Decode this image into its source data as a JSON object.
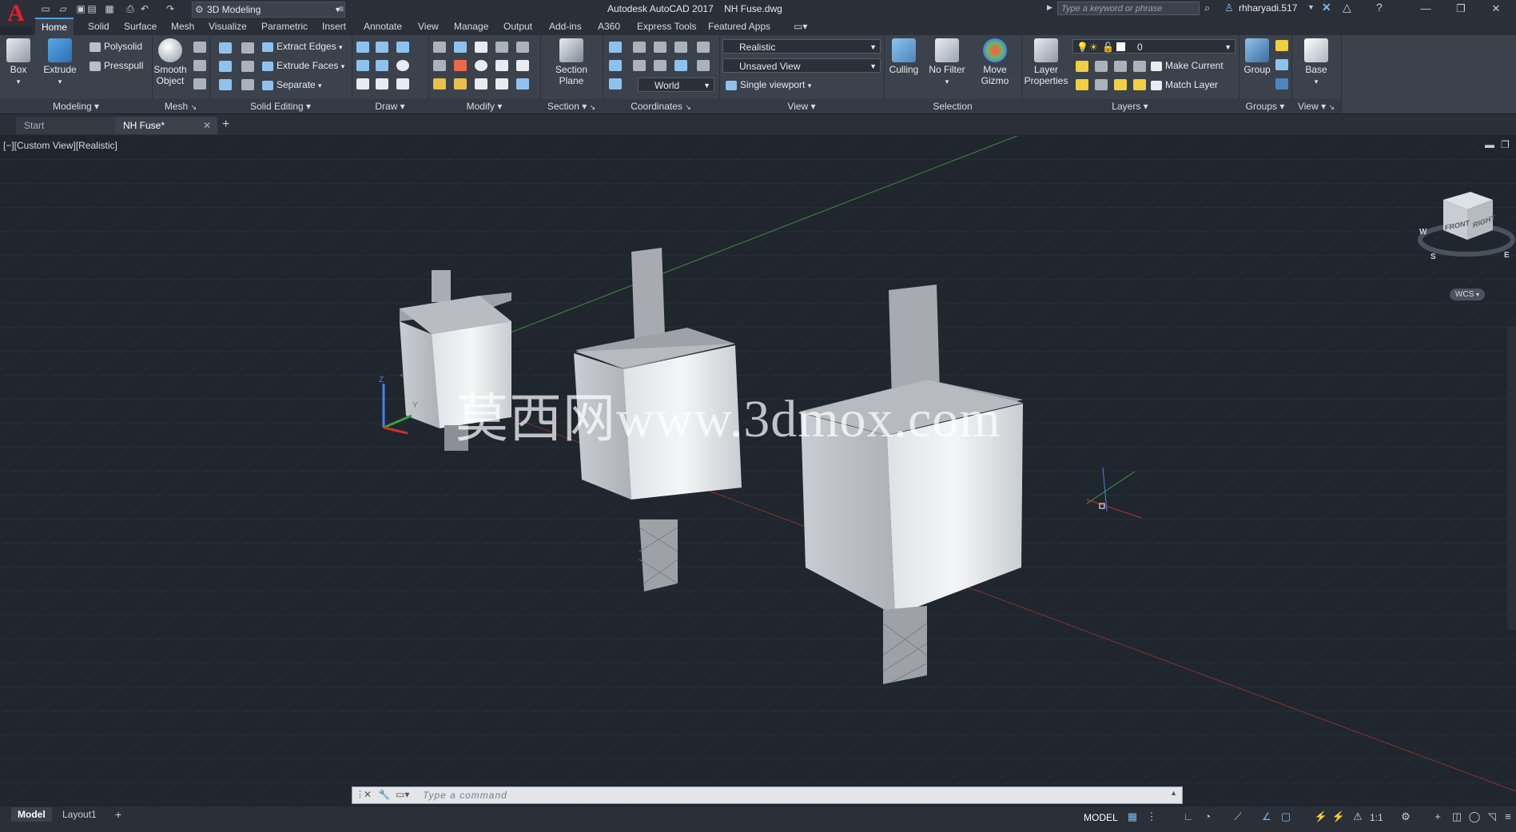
{
  "titlebar": {
    "app_name": "Autodesk AutoCAD 2017",
    "file_name": "NH Fuse.dwg",
    "workspace": "3D Modeling",
    "search_placeholder": "Type a keyword or phrase",
    "user": "rhharyadi.517"
  },
  "ribbon_tabs": [
    "Home",
    "Solid",
    "Surface",
    "Mesh",
    "Visualize",
    "Parametric",
    "Insert",
    "Annotate",
    "View",
    "Manage",
    "Output",
    "Add-ins",
    "A360",
    "Express Tools",
    "Featured Apps"
  ],
  "ribbon": {
    "modeling": {
      "title": "Modeling",
      "box": "Box",
      "extrude": "Extrude",
      "polysolid": "Polysolid",
      "presspull": "Presspull"
    },
    "mesh": {
      "title": "Mesh",
      "smooth_object_1": "Smooth",
      "smooth_object_2": "Object"
    },
    "solid_editing": {
      "title": "Solid Editing",
      "extract_edges": "Extract Edges",
      "extrude_faces": "Extrude Faces",
      "separate": "Separate"
    },
    "draw": {
      "title": "Draw"
    },
    "modify": {
      "title": "Modify"
    },
    "section": {
      "title": "Section",
      "section_plane_1": "Section",
      "section_plane_2": "Plane"
    },
    "coordinates": {
      "title": "Coordinates",
      "world": "World"
    },
    "view": {
      "title": "View",
      "visual_style": "Realistic",
      "named_view": "Unsaved View",
      "viewport": "Single viewport"
    },
    "selection": {
      "title": "Selection",
      "culling": "Culling",
      "no_filter": "No Filter",
      "move_gizmo_1": "Move",
      "move_gizmo_2": "Gizmo"
    },
    "layers": {
      "title": "Layers",
      "layer_properties_1": "Layer",
      "layer_properties_2": "Properties",
      "current_layer": "0",
      "make_current": "Make Current",
      "match_layer": "Match Layer"
    },
    "groups": {
      "title": "Groups",
      "group": "Group"
    },
    "view2": {
      "title": "View",
      "base": "Base"
    }
  },
  "doc_tabs": [
    "Start",
    "NH Fuse*"
  ],
  "viewport": {
    "label": "[−][Custom View][Realistic]",
    "watermark": "莫西网www.3dmox.com",
    "viewcube_front": "FRONT",
    "viewcube_right": "RIGHT",
    "viewcube_w": "W",
    "viewcube_s": "S",
    "viewcube_e": "E",
    "wcs": "WCS"
  },
  "command_line": {
    "placeholder": "Type a command"
  },
  "layout_tabs": [
    "Model",
    "Layout1"
  ],
  "status": {
    "model": "MODEL",
    "scale": "1:1"
  },
  "colors": {
    "accent": "#4aa0e0",
    "logo": "#e8202a",
    "bg": "#1f262e"
  }
}
